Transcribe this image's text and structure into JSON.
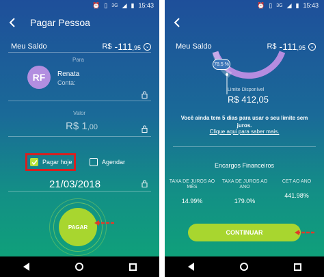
{
  "status": {
    "network": "3G",
    "time": "15:43"
  },
  "left": {
    "title": "Pagar Pessoa",
    "saldo_label": "Meu Saldo",
    "saldo_currency": "R$",
    "saldo_value": "-111",
    "saldo_cents": ",95",
    "para_label": "Para",
    "contact_initials": "RF",
    "contact_name": "Renata",
    "contact_conta": "Conta:",
    "valor_label": "Valor",
    "valor_currency": "R$",
    "valor_value": "1",
    "valor_cents": ",00",
    "pagar_hoje_label": "Pagar hoje",
    "agendar_label": "Agendar",
    "date": "21/03/2018",
    "pagar_button": "PAGAR"
  },
  "right": {
    "saldo_label": "Meu Saldo",
    "saldo_currency": "R$",
    "saldo_value": "-111",
    "saldo_cents": ",95",
    "gauge_percent": "78.5 %",
    "limite_label": "Limite Disponível",
    "limite_value": "R$ 412,05",
    "info_text": "Você ainda tem 5 dias para usar o seu limite sem juros.",
    "info_link": "Clique aqui para saber mais.",
    "encargos_title": "Encargos Financeiros",
    "columns": [
      {
        "header": "TAXA DE JUROS AO MÊS",
        "value": "14.99%"
      },
      {
        "header": "TAXA DE JUROS AO ANO",
        "value": "179.0%"
      },
      {
        "header": "CET AO ANO",
        "value": "441.98%"
      }
    ],
    "continuar_button": "CONTINUAR"
  },
  "colors": {
    "accent_green": "#a8d62f",
    "highlight_red": "#d62020",
    "arrow_red": "#e03a2a"
  }
}
